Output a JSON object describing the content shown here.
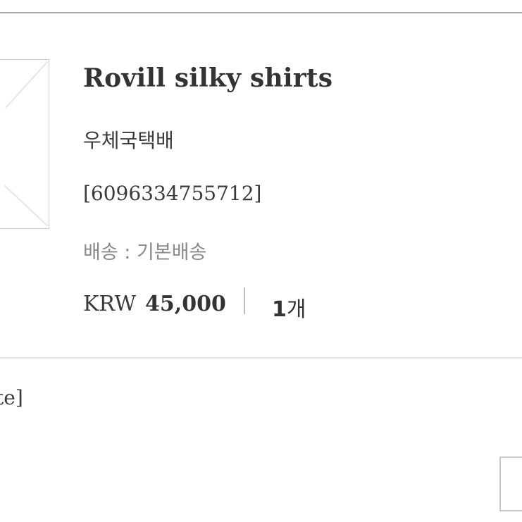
{
  "product": {
    "name": "Rovill silky shirts",
    "carrier": "우체국택배",
    "tracking_number": "[6096334755712]",
    "shipping_info": "배송 : 기본배송",
    "price_currency": "KRW",
    "price_amount": "45,000",
    "quantity_number": "1",
    "quantity_unit": "개"
  },
  "option": {
    "text": "te]"
  },
  "colors": {
    "text": "#333333",
    "muted_text": "#8a8a8a",
    "divider": "#bdbdbd"
  }
}
